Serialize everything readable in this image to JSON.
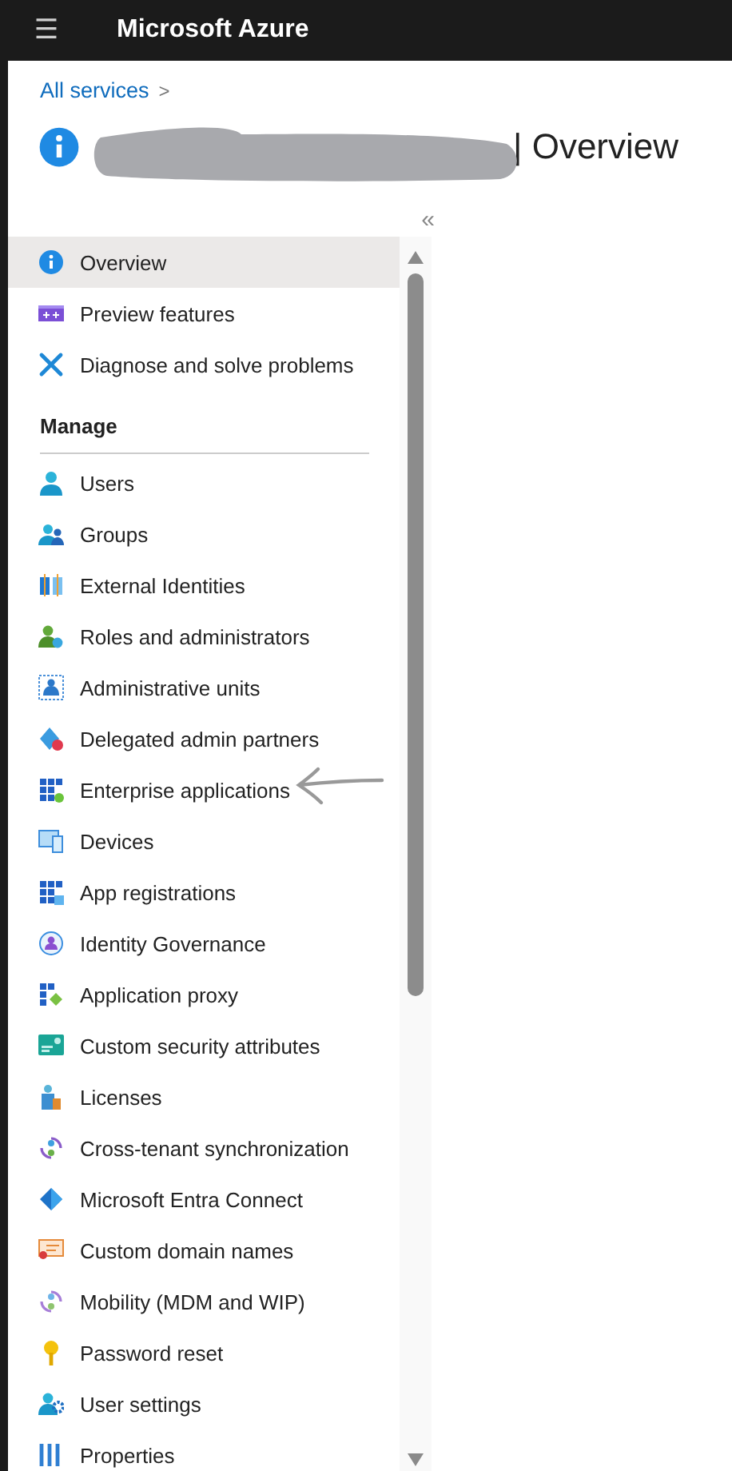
{
  "header": {
    "menu_glyph": "☰",
    "title": "Microsoft Azure"
  },
  "breadcrumb": {
    "link": "All services",
    "separator": ">"
  },
  "page_title": {
    "text": "| Overview"
  },
  "sidebar": {
    "collapse_glyph": "«",
    "top_items": [
      {
        "label": "Overview",
        "selected": true
      },
      {
        "label": "Preview features",
        "selected": false
      },
      {
        "label": "Diagnose and solve problems",
        "selected": false
      }
    ],
    "section": "Manage",
    "manage_items": [
      {
        "label": "Users",
        "selected": false
      },
      {
        "label": "Groups",
        "selected": false
      },
      {
        "label": "External Identities",
        "selected": false
      },
      {
        "label": "Roles and administrators",
        "selected": false
      },
      {
        "label": "Administrative units",
        "selected": false
      },
      {
        "label": "Delegated admin partners",
        "selected": false
      },
      {
        "label": "Enterprise applications",
        "selected": false
      },
      {
        "label": "Devices",
        "selected": false
      },
      {
        "label": "App registrations",
        "selected": false
      },
      {
        "label": "Identity Governance",
        "selected": false
      },
      {
        "label": "Application proxy",
        "selected": false
      },
      {
        "label": "Custom security attributes",
        "selected": false
      },
      {
        "label": "Licenses",
        "selected": false
      },
      {
        "label": "Cross-tenant synchronization",
        "selected": false
      },
      {
        "label": "Microsoft Entra Connect",
        "selected": false
      },
      {
        "label": "Custom domain names",
        "selected": false
      },
      {
        "label": "Mobility (MDM and WIP)",
        "selected": false
      },
      {
        "label": "Password reset",
        "selected": false
      },
      {
        "label": "User settings",
        "selected": false
      },
      {
        "label": "Properties",
        "selected": false
      }
    ]
  }
}
